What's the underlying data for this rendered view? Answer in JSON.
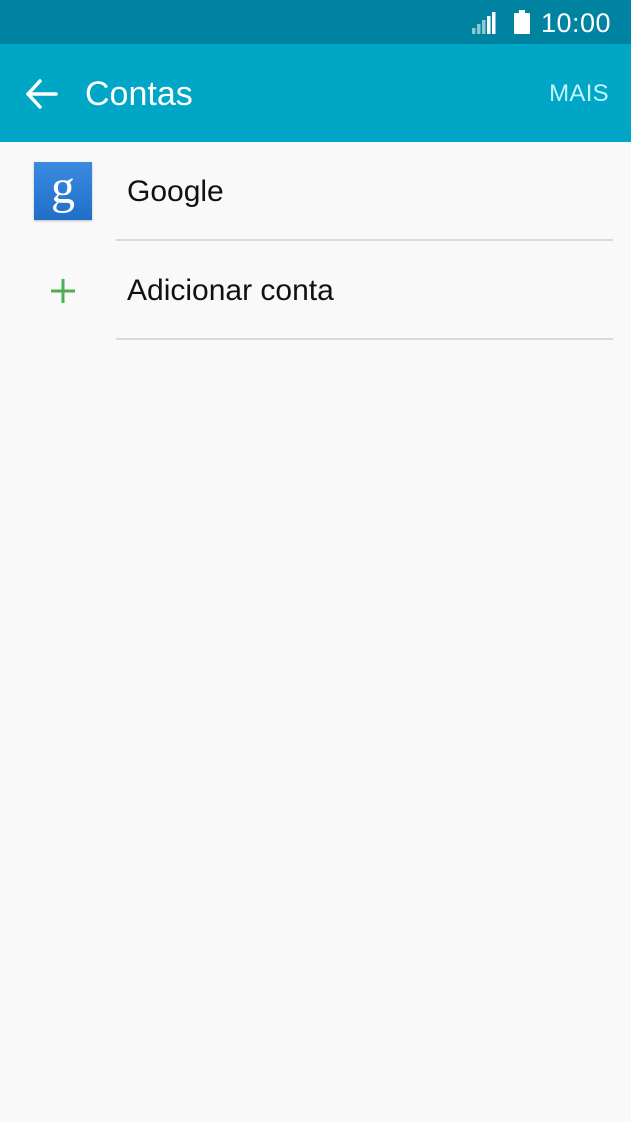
{
  "status_bar": {
    "time": "10:00",
    "signal_icon": "cell-signal-icon",
    "battery_icon": "battery-icon"
  },
  "app_bar": {
    "back_icon": "arrow-back-icon",
    "title": "Contas",
    "more_label": "MAIS",
    "colors": {
      "status_bar": "#0083a0",
      "app_bar": "#00a6c6",
      "more_text": "#bff7ff"
    }
  },
  "accounts": {
    "items": [
      {
        "label": "Google",
        "icon": "google-g-icon",
        "icon_glyph": "g"
      },
      {
        "label": "Adicionar conta",
        "icon": "plus-icon",
        "icon_color": "#4caf50"
      }
    ]
  }
}
